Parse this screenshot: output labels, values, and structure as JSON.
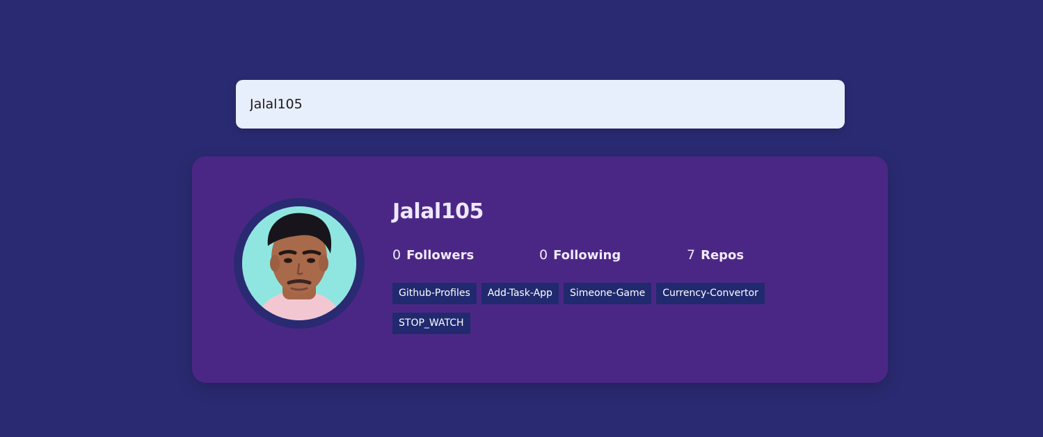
{
  "search": {
    "value": "Jalal105"
  },
  "profile": {
    "name": "Jalal105",
    "followers_count": "0",
    "followers_label": "Followers",
    "following_count": "0",
    "following_label": "Following",
    "repos_count": "7",
    "repos_label": "Repos",
    "repositories": [
      "Github-Profiles",
      "Add-Task-App",
      "Simeone-Game",
      "Currency-Convertor",
      "STOP_WATCH"
    ]
  },
  "colors": {
    "background": "#2a2a72",
    "card": "#4b2785",
    "input": "#e8effc",
    "repo_tag": "#212a6f"
  }
}
